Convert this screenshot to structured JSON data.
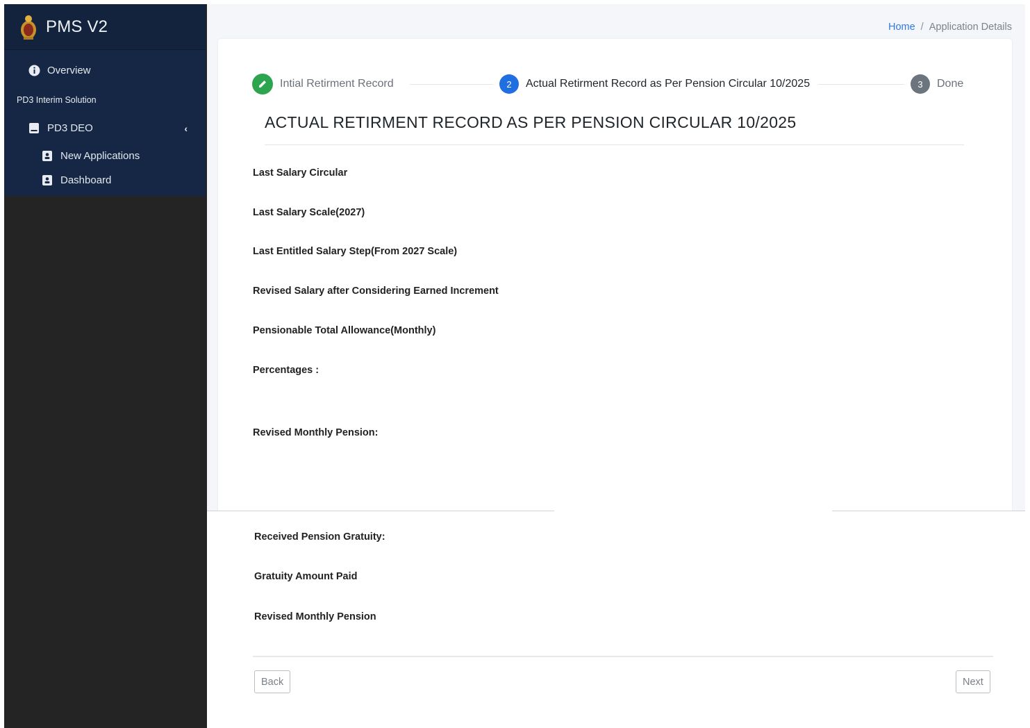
{
  "app": {
    "title": "PMS V2"
  },
  "sidebar": {
    "overview_label": "Overview",
    "section_label": "PD3 Interim Solution",
    "group_label": "PD3 DEO",
    "items": [
      {
        "label": "New Applications"
      },
      {
        "label": "Dashboard"
      }
    ]
  },
  "breadcrumb": {
    "home": "Home",
    "separator": "/",
    "current": "Application Details"
  },
  "stepper": {
    "steps": [
      {
        "label": "Intial Retirment Record",
        "number": "",
        "status": "completed"
      },
      {
        "label": "Actual Retirment Record as Per Pension Circular 10/2025",
        "number": "2",
        "status": "active"
      },
      {
        "label": "Done",
        "number": "3",
        "status": "pending"
      }
    ]
  },
  "section": {
    "title": "ACTUAL RETIRMENT RECORD AS PER PENSION CIRCULAR 10/2025"
  },
  "fields": [
    "Last Salary Circular",
    "Last Salary Scale(2027)",
    "Last Entitled Salary Step(From 2027 Scale)",
    "Revised Salary after Considering Earned Increment",
    "Pensionable Total Allowance(Monthly)",
    "Percentages :",
    "Revised Monthly Pension:",
    "Received Pension Gratuity:",
    "Gratuity Amount Paid",
    "Revised Monthly Pension"
  ],
  "buttons": {
    "back": "Back",
    "next": "Next"
  },
  "colors": {
    "sidebar": "#152744",
    "active_step": "#1f6fe0",
    "completed_step": "#2da44e",
    "pending_step": "#6c757d",
    "link": "#2f7ae5"
  }
}
